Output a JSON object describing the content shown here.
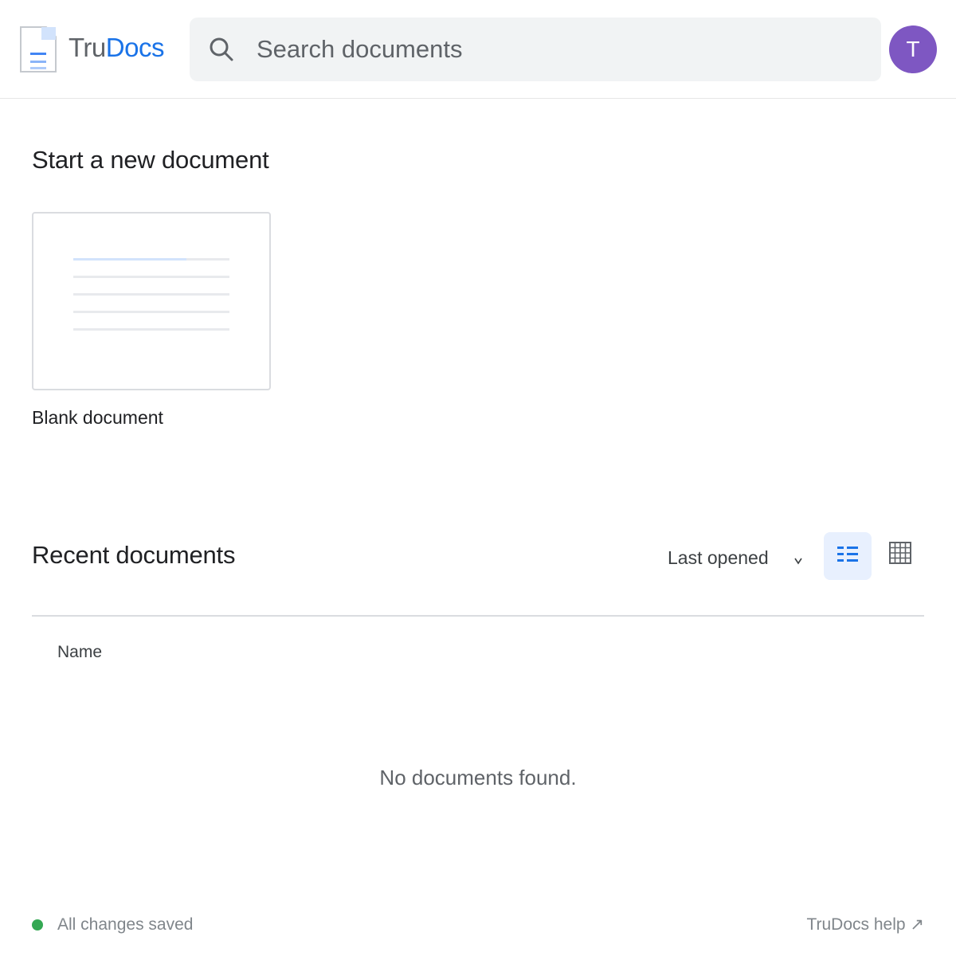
{
  "header": {
    "logo": {
      "text_part1": "Tru",
      "text_part2": "Docs",
      "brand_color": "#1a73e8"
    },
    "search": {
      "placeholder": "Search documents",
      "value": "",
      "icon": "search-icon"
    },
    "avatar": {
      "initial": "T",
      "color": "#7e57c2"
    }
  },
  "start_section": {
    "title": "Start a new document",
    "templates": [
      {
        "label": "Blank document",
        "icon": "blank-document-thumbnail"
      }
    ]
  },
  "recent_section": {
    "title": "Recent documents",
    "sort": {
      "selected": "Last opened",
      "icon": "chevron-down-icon"
    },
    "view_modes": {
      "active": "list",
      "list_icon": "list-view-icon",
      "grid_icon": "grid-view-icon"
    },
    "columns": [
      "Name"
    ],
    "rows": [],
    "empty_message": "No documents found."
  },
  "footer": {
    "status": "All changes saved",
    "status_color": "#34a853",
    "help_link": "TruDocs help ↗"
  }
}
